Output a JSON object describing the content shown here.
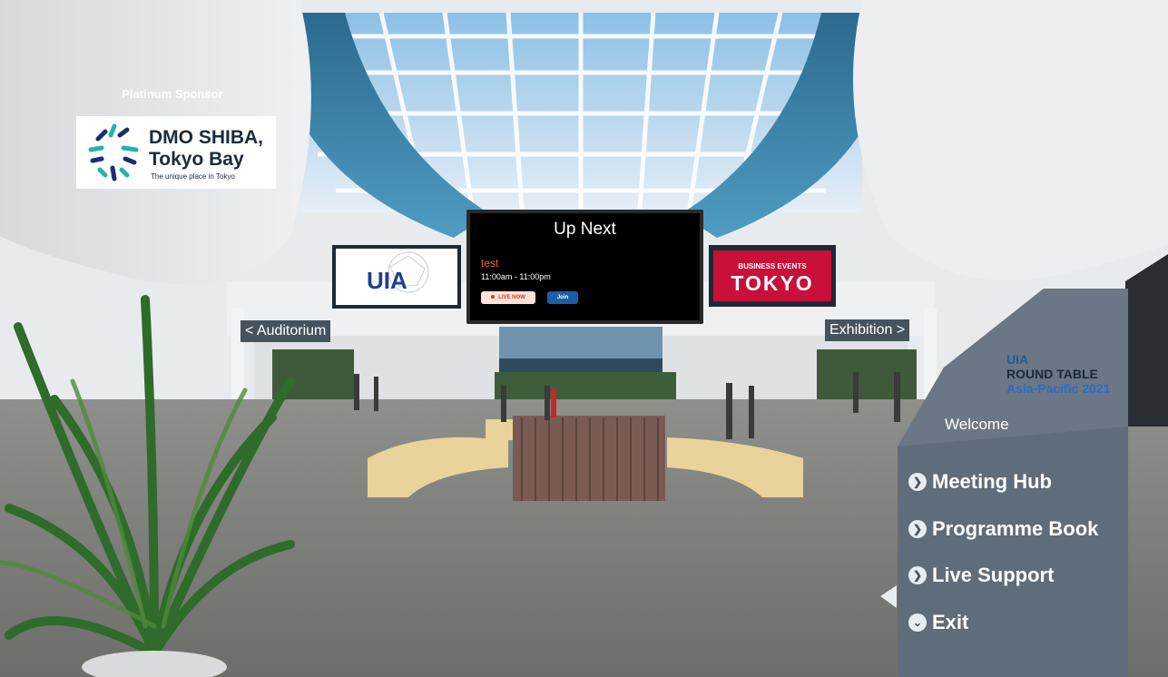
{
  "sponsor": {
    "caption": "Platinum Sponsor",
    "name_line1": "DMO SHIBA,",
    "name_line2": "Tokyo Bay",
    "tagline": "The unique place in Tokyo"
  },
  "screen": {
    "title": "Up Next",
    "event_name": "test",
    "event_time": "11:00am - 11:00pm",
    "live_label": "LIVE NOW",
    "join_label": "Join"
  },
  "boards": {
    "uia_text": "UIA",
    "bet_line1": "BUSINESS EVENTS",
    "bet_line2": "TOKYO"
  },
  "nav": {
    "auditorium": "< Auditorium",
    "exhibition": "Exhibition >"
  },
  "sidebar": {
    "art_line1": "UIA",
    "art_line2": "ROUND TABLE",
    "art_line3": "Asia-Pacific 2021",
    "welcome": "Welcome",
    "items": [
      {
        "label": "Meeting Hub",
        "icon": "chevron-right-icon"
      },
      {
        "label": "Programme Book",
        "icon": "chevron-right-icon"
      },
      {
        "label": "Live Support",
        "icon": "chevron-right-icon"
      },
      {
        "label": "Exit",
        "icon": "chevron-down-icon"
      }
    ]
  },
  "colors": {
    "sidebar": "#5f6c7a",
    "sign": "#47525f",
    "live": "#ff5a2a",
    "join": "#1a5fa8",
    "tokyo_red": "#c8103a"
  }
}
